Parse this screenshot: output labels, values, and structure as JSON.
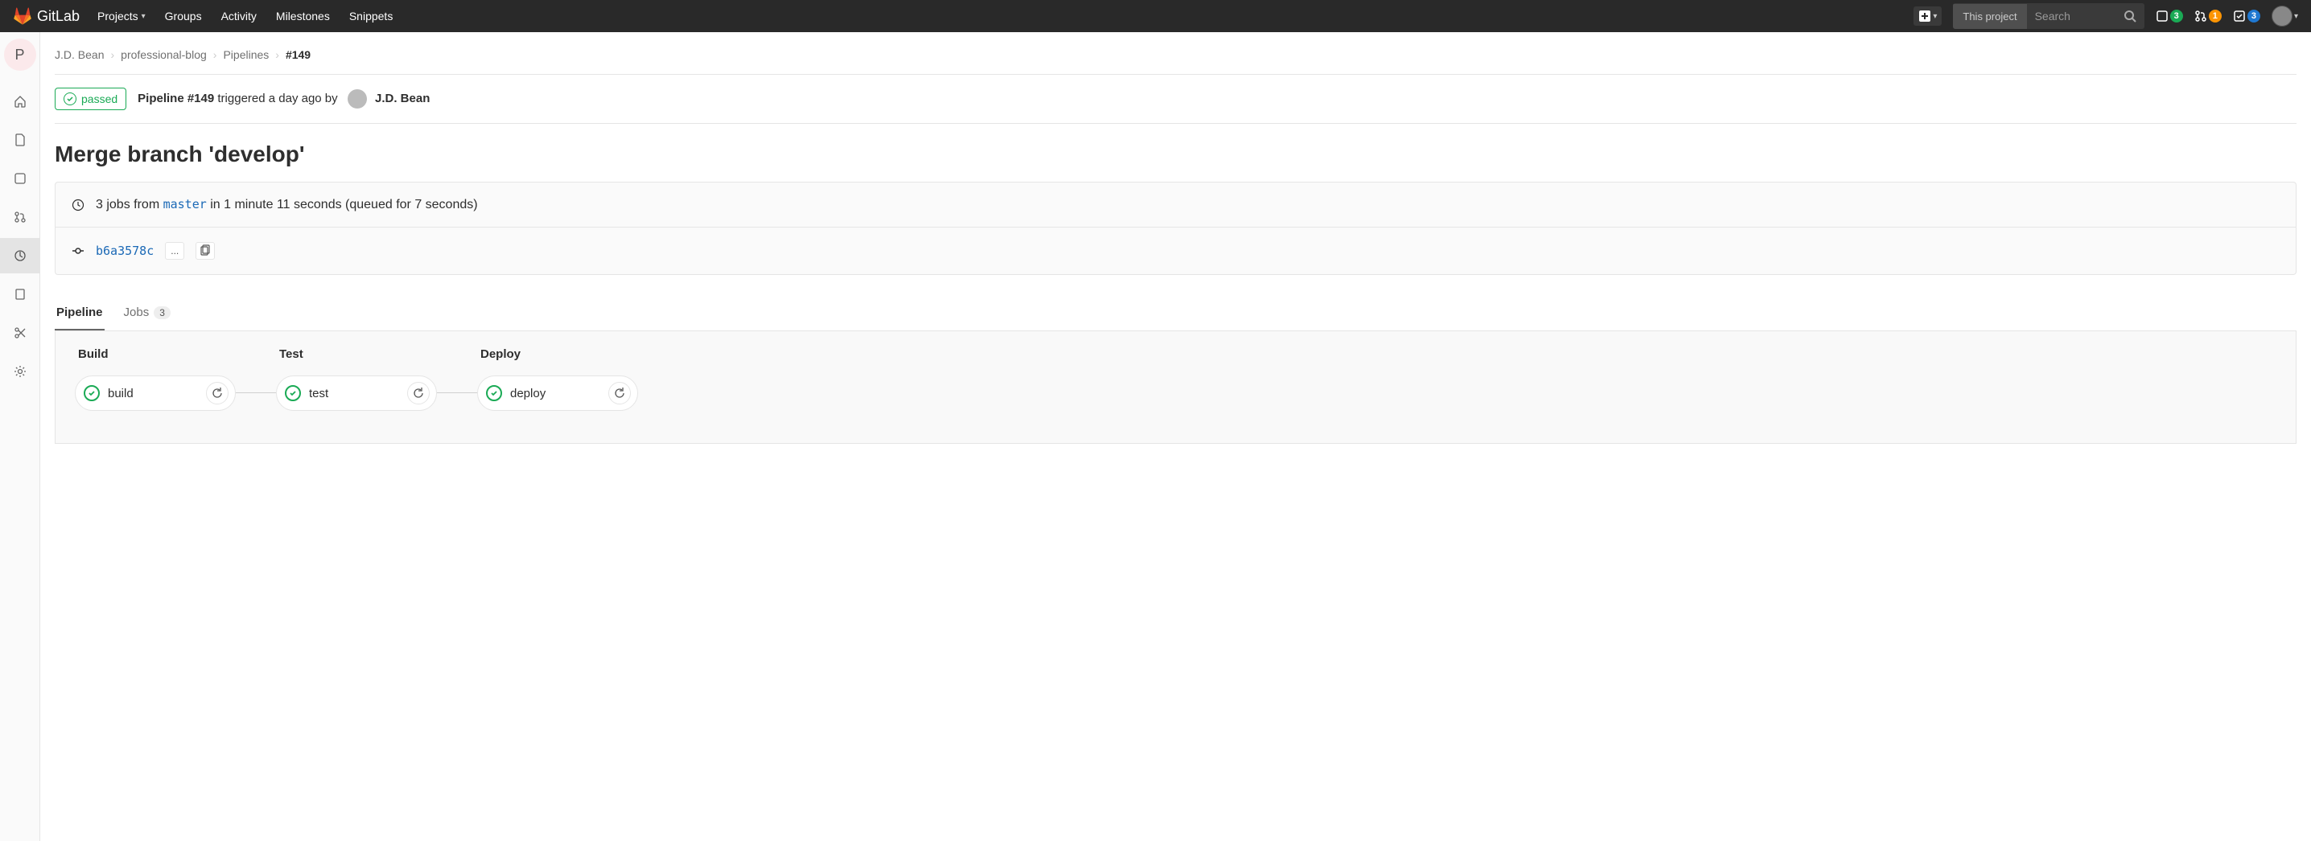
{
  "brand": "GitLab",
  "nav": {
    "projects": "Projects",
    "groups": "Groups",
    "activity": "Activity",
    "milestones": "Milestones",
    "snippets": "Snippets"
  },
  "search": {
    "scope": "This project",
    "placeholder": "Search"
  },
  "counters": {
    "issues": "3",
    "mrs": "1",
    "todos": "3"
  },
  "sidebar": {
    "project_letter": "P"
  },
  "breadcrumb": {
    "owner": "J.D. Bean",
    "project": "professional-blog",
    "section": "Pipelines",
    "current": "#149"
  },
  "status_badge": "passed",
  "pipeline_header": {
    "prefix": "Pipeline #149",
    "mid": " triggered a day ago by",
    "author": "J.D. Bean"
  },
  "commit_title": "Merge branch 'develop'",
  "info": {
    "jobs_prefix": "3 jobs from ",
    "branch": "master",
    "jobs_suffix": " in 1 minute 11 seconds (queued for 7 seconds)",
    "sha": "b6a3578c",
    "ellipsis": "..."
  },
  "tabs": {
    "pipeline": "Pipeline",
    "jobs": "Jobs",
    "jobs_count": "3"
  },
  "stages": {
    "build": {
      "title": "Build",
      "job": "build"
    },
    "test": {
      "title": "Test",
      "job": "test"
    },
    "deploy": {
      "title": "Deploy",
      "job": "deploy"
    }
  }
}
